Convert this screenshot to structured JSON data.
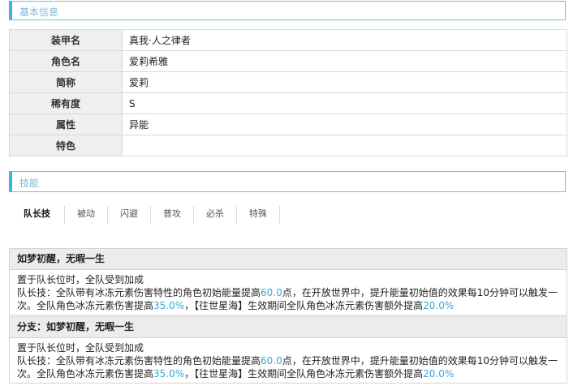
{
  "basic_header": "基本信息",
  "skill_header": "技能",
  "info_rows": [
    {
      "key": "装甲名",
      "value": "真我·人之律者"
    },
    {
      "key": "角色名",
      "value": "爱莉希雅"
    },
    {
      "key": "简称",
      "value": "爱莉"
    },
    {
      "key": "稀有度",
      "value": "S"
    },
    {
      "key": "属性",
      "value": "异能"
    },
    {
      "key": "特色",
      "value": ""
    }
  ],
  "tabs": [
    "队长技",
    "被动",
    "闪避",
    "普攻",
    "必杀",
    "特殊"
  ],
  "skills": [
    {
      "title": "如梦初醒，无暇一生",
      "line1": "置于队长位时，全队受到加成",
      "p1": "队长技：全队带有冰冻元素伤害特性的角色初始能量提高",
      "v1": "60.0",
      "p2": "点，在开放世界中，提升能量初始值的效果每10分钟可以触发一次。全队角色冰冻元素伤害提高",
      "v2": "35.0%",
      "p3": "，【往世星海】生效期间全队角色冰冻元素伤害额外提高",
      "v3": "20.0%"
    },
    {
      "title": "分支：如梦初醒，无暇一生",
      "line1": "置于队长位时，全队受到加成",
      "p1": "队长技：全队带有冰冻元素伤害特性的角色初始能量提高",
      "v1": "60.0",
      "p2": "点，在开放世界中，提升能量初始值的效果每10分钟可以触发一次。全队角色冰冻元素伤害提高",
      "v2": "35.0%",
      "p3": "，【往世星海】生效期间全队角色冰冻元素伤害额外提高",
      "v3": "20.0%"
    }
  ],
  "colors": {
    "accent": "#39b5e0",
    "highlight": "#39a8d6",
    "label_bg": "#efefef"
  }
}
